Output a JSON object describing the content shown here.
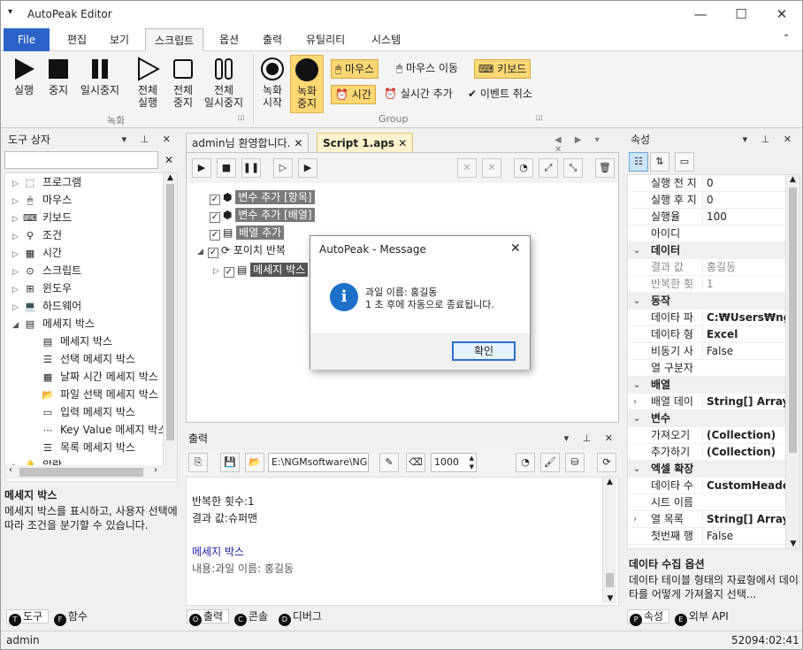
{
  "app": {
    "title": "AutoPeak Editor"
  },
  "menu": {
    "file": "File",
    "items": [
      "편집",
      "보기",
      "스크립트",
      "옵션",
      "출력",
      "유틸리티",
      "시스템"
    ]
  },
  "ribbon": {
    "run": "실행",
    "stop": "중지",
    "pause": "일시중지",
    "run_all": [
      "전체",
      "실행"
    ],
    "stop_all": [
      "전체",
      "중지"
    ],
    "pause_all": [
      "전체",
      "일시중지"
    ],
    "rec_start": [
      "녹화",
      "시작"
    ],
    "rec_stop": [
      "녹화",
      "중지"
    ],
    "group_record": "녹화",
    "group_group": "Group",
    "mouse": "마우스",
    "mouse_move": "마우스 이동",
    "keyboard": "키보드",
    "time": "시간",
    "realtime_add": "실시간 추가",
    "event_cancel": "이벤트 취소"
  },
  "toolbox": {
    "title": "도구 상자",
    "items": [
      "프로그램",
      "마우스",
      "키보드",
      "조건",
      "시간",
      "스크립트",
      "윈도우",
      "하드웨어",
      "메세지 박스"
    ],
    "sub": [
      "메세지 박스",
      "선택 메세지 박스",
      "날짜 시간 메세지 박스",
      "파일 선택 메세지 박스",
      "입력 메세지 박스",
      "Key Value 메세지 박스",
      "목록 메세지 박스"
    ],
    "last": "알람",
    "desc_title": "메세지 박스",
    "desc_text": "메세지 박스를 표시하고, 사용자 선택에 따라 조건을 분기할 수 있습니다.",
    "tabs": [
      "도구",
      "함수"
    ]
  },
  "editor": {
    "tabs": [
      "admin님 환영합니다.",
      "Script 1.aps"
    ],
    "nodes": [
      "변수 추가 [항목]",
      "변수 추가 [배열]",
      "배열 추가",
      "포이치 반복",
      "메세지 박스"
    ]
  },
  "dialog": {
    "title": "AutoPeak - Message",
    "line1": "과일 이름: 홍길동",
    "line2": "1 초 후에 자동으로 종료됩니다.",
    "ok": "확인"
  },
  "output": {
    "title": "출력",
    "path": "E:\\NGMsoftware\\NG",
    "num": "1000",
    "lines": [
      "반복한 횟수:1",
      "결과 값:슈퍼맨"
    ],
    "heading": "메세지 박스",
    "content": "내용:과일 이름: 홍길동",
    "tabs": [
      "출력",
      "콘솔",
      "디버그"
    ]
  },
  "props": {
    "title": "속성",
    "rows_top": [
      [
        "실행 전 지",
        "0"
      ],
      [
        "실행 후 지",
        "0"
      ],
      [
        "실행율",
        "100"
      ],
      [
        "아이디",
        ""
      ]
    ],
    "cat_data": "데이터",
    "rows_data": [
      [
        "결과 값",
        "홍길동"
      ],
      [
        "반복한 횟",
        "1"
      ]
    ],
    "cat_action": "동작",
    "rows_action": [
      [
        "데이타 파",
        "C:₩Users₩ngma"
      ],
      [
        "데이타 형",
        "Excel"
      ],
      [
        "비동기 사",
        "False"
      ],
      [
        "열 구분자",
        ""
      ]
    ],
    "cat_array": "배열",
    "rows_array": [
      [
        "배열 데이",
        "String[] Array"
      ]
    ],
    "cat_var": "변수",
    "rows_var": [
      [
        "가져오기",
        "(Collection)"
      ],
      [
        "추가하기",
        "(Collection)"
      ]
    ],
    "cat_excel": "엑셀 확장",
    "rows_excel": [
      [
        "데이타 수",
        "CustomHeaderC"
      ],
      [
        "시트 이름",
        ""
      ],
      [
        "열 목록",
        "String[] Array"
      ],
      [
        "첫번째 행",
        "False"
      ]
    ],
    "desc_title": "데이타 수집 옵션",
    "desc_text": "데이타 테이블 형태의 자료형에서 데이타를 어떻게 가져올지 선택...",
    "tabs": [
      "속성",
      "외부 API"
    ]
  },
  "status": {
    "user": "admin",
    "time": "52094:02:41"
  }
}
